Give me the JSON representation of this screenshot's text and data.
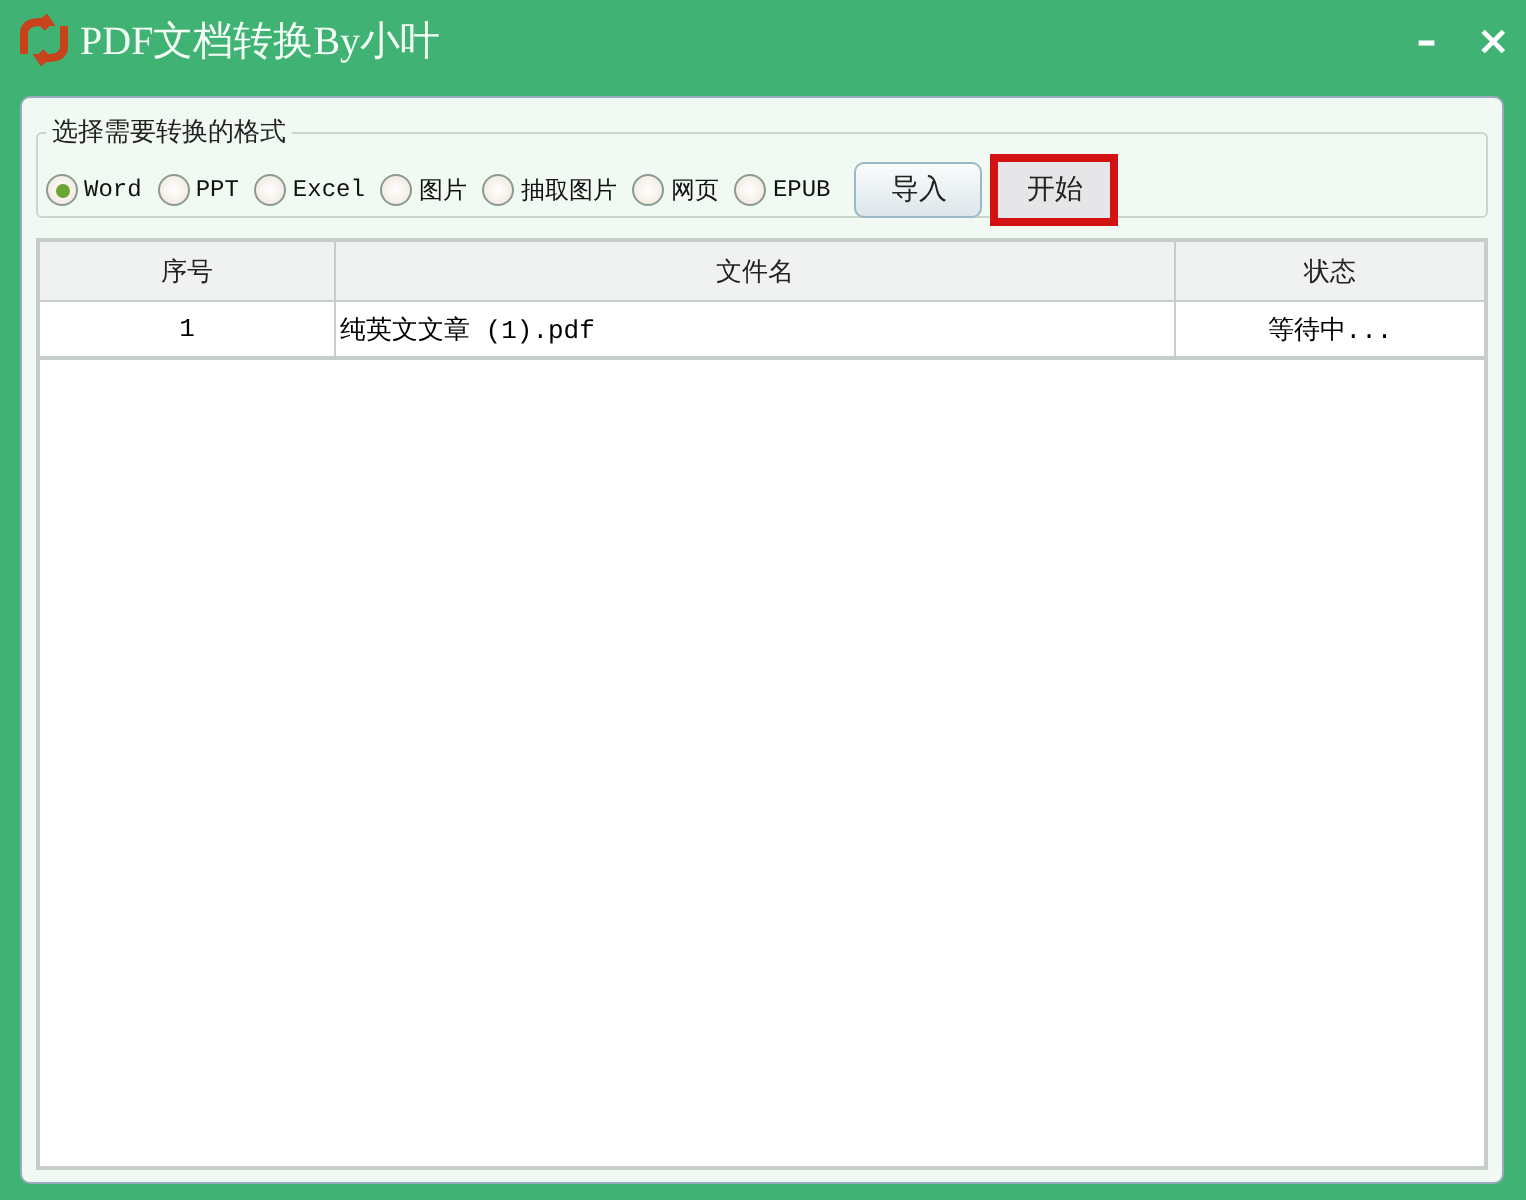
{
  "window": {
    "title": "PDF文档转换By小叶",
    "controls": [
      "–",
      "×"
    ]
  },
  "format_group": {
    "legend": "选择需要转换的格式",
    "options": [
      {
        "label": "Word",
        "selected": true
      },
      {
        "label": "PPT",
        "selected": false
      },
      {
        "label": "Excel",
        "selected": false
      },
      {
        "label": "图片",
        "selected": false
      },
      {
        "label": "抽取图片",
        "selected": false
      },
      {
        "label": "网页",
        "selected": false
      },
      {
        "label": "EPUB",
        "selected": false
      }
    ],
    "buttons": [
      {
        "label": "导入",
        "highlighted": false
      },
      {
        "label": "开始",
        "highlighted": true
      }
    ]
  },
  "table": {
    "columns": [
      "序号",
      "文件名",
      "状态"
    ],
    "rows": [
      [
        "1",
        "纯英文文章 (1).pdf",
        "等待中..."
      ]
    ]
  }
}
